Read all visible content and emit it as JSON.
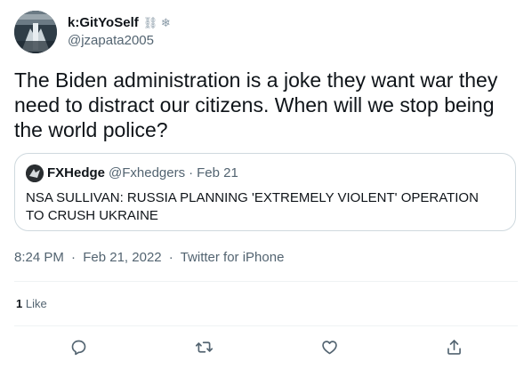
{
  "author": {
    "display_name": "k:GitYoSelf",
    "handle": "@jzapata2005",
    "name_emojis": "⛓ ❄"
  },
  "tweet": {
    "text": "The Biden administration is a joke they want war they need to distract our citizens. When will we stop being the world police?"
  },
  "quoted_tweet": {
    "name": "FXHedge",
    "handle": "@Fxhedgers",
    "separator": "·",
    "date": "Feb 21",
    "text": "NSA SULLIVAN: RUSSIA PLANNING 'EXTREMELY VIOLENT' OPERATION TO CRUSH UKRAINE"
  },
  "meta": {
    "time": "8:24 PM",
    "date": "Feb 21, 2022",
    "source": "Twitter for iPhone",
    "separator": "·"
  },
  "engagement": {
    "like_count": "1",
    "like_label": "Like"
  },
  "icons": {
    "reply": "reply-icon",
    "retweet": "retweet-icon",
    "like": "like-icon",
    "share": "share-icon"
  },
  "colors": {
    "text": "#0f1419",
    "muted": "#536471",
    "border": "#cfd9de",
    "divider": "#eff3f4"
  }
}
